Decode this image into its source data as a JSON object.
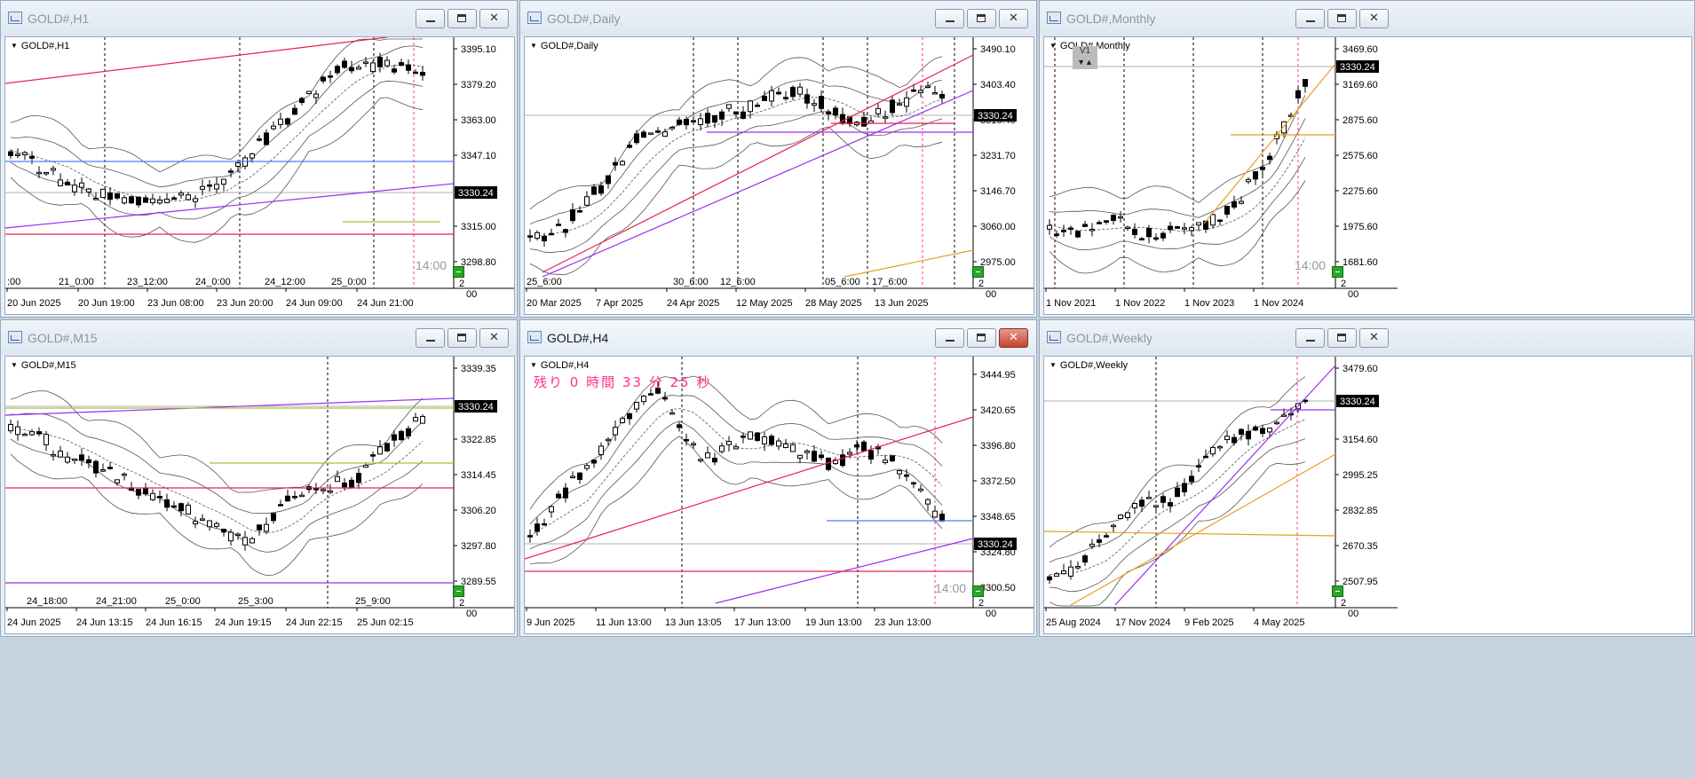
{
  "windows": [
    {
      "id": "h1",
      "title": "GOLD#,H1",
      "symbol": "GOLD#,H1",
      "active": false,
      "price_labels": [
        "3395.10",
        "3379.20",
        "3363.00",
        "3347.10",
        "3315.00",
        "3298.80"
      ],
      "current_price": "3330.24",
      "time_labels": [
        "20 Jun 2025",
        "20 Jun 19:00",
        "23 Jun 08:00",
        "23 Jun 20:00",
        "24 Jun 09:00",
        "24 Jun 21:00"
      ],
      "separator_labels": [
        ":00",
        "21_0:00",
        "23_12:00",
        "24_0:00",
        "24_12:00",
        "25_0:00"
      ],
      "timeframe_overlay": "14:00",
      "corner_marks": [
        "2",
        "00"
      ]
    },
    {
      "id": "daily",
      "title": "GOLD#,Daily",
      "symbol": "GOLD#,Daily",
      "active": false,
      "price_labels": [
        "3490.10",
        "3403.40",
        "3316.40",
        "3231.70",
        "3146.70",
        "3060.00",
        "2975.00"
      ],
      "current_price": "3330.24",
      "time_labels": [
        "20 Mar 2025",
        "7 Apr 2025",
        "24 Apr 2025",
        "12 May 2025",
        "28 May 2025",
        "13 Jun 2025"
      ],
      "separator_labels": [
        "25_6:00",
        "30_6:00",
        "12_6:00",
        "05_6:00",
        "17_6:00"
      ],
      "corner_marks": [
        "2",
        "00"
      ]
    },
    {
      "id": "monthly",
      "title": "GOLD#,Monthly",
      "symbol": "GOLD#,Monthly",
      "active": false,
      "price_labels": [
        "3469.60",
        "3169.60",
        "2875.60",
        "2575.60",
        "2275.60",
        "1975.60",
        "1681.60"
      ],
      "current_price": "3330.24",
      "time_labels": [
        "1 Nov 2021",
        "1 Nov 2022",
        "1 Nov 2023",
        "1 Nov 2024"
      ],
      "timeframe_overlay": "14:00",
      "corner_marks": [
        "2",
        "00"
      ],
      "v1_label": "V1"
    },
    {
      "id": "m15",
      "title": "GOLD#,M15",
      "symbol": "GOLD#,M15",
      "active": false,
      "price_labels": [
        "3339.35",
        "3322.85",
        "3314.45",
        "3306.20",
        "3297.80",
        "3289.55"
      ],
      "current_price": "3330.24",
      "time_labels": [
        "24 Jun 2025",
        "24 Jun 13:15",
        "24 Jun 16:15",
        "24 Jun 19:15",
        "24 Jun 22:15",
        "25 Jun 02:15"
      ],
      "separator_labels": [
        "24_18:00",
        "24_21:00",
        "25_0:00",
        "25_3:00",
        "25_9:00"
      ],
      "corner_marks": [
        "2",
        "00"
      ]
    },
    {
      "id": "h4",
      "title": "GOLD#,H4",
      "symbol": "GOLD#,H4",
      "active": true,
      "countdown": "残り 0 時間 33 分 25 秒",
      "price_labels": [
        "3444.95",
        "3420.65",
        "3396.80",
        "3372.50",
        "3348.65",
        "3324.80",
        "3300.50"
      ],
      "current_price": "3330.24",
      "time_labels": [
        "9 Jun 2025",
        "11 Jun 13:00",
        "13 Jun 13:05",
        "17 Jun 13:00",
        "19 Jun 13:00",
        "23 Jun 13:00"
      ],
      "timeframe_overlay": "14:00",
      "corner_marks": [
        "2",
        "00"
      ]
    },
    {
      "id": "weekly",
      "title": "GOLD#,Weekly",
      "symbol": "GOLD#,Weekly",
      "active": false,
      "price_labels": [
        "3479.60",
        "3154.60",
        "2995.25",
        "2832.85",
        "2670.35",
        "2507.95"
      ],
      "current_price": "3330.24",
      "time_labels": [
        "25 Aug 2024",
        "17 Nov 2024",
        "9 Feb 2025",
        "4 May 2025"
      ],
      "corner_marks": [
        "2",
        "00"
      ]
    }
  ],
  "colors": {
    "red_line": "#e8244a",
    "purple_line": "#9b2cf0",
    "blue_line": "#4a7ff0",
    "orange_line": "#e8a020",
    "olive_line": "#a8c040",
    "magenta_marker": "#ff2db0",
    "price_tag_bg": "#000000",
    "signal_green": "#2aa52a"
  }
}
